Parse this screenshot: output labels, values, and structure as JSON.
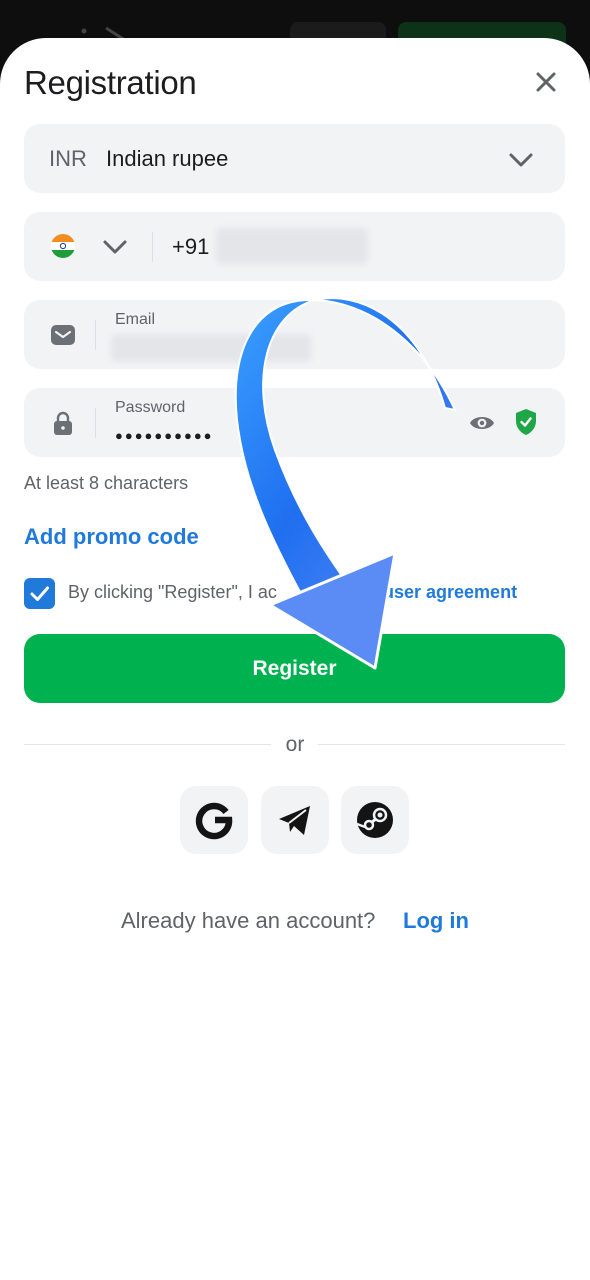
{
  "header": {
    "title": "Registration"
  },
  "currency": {
    "code": "INR",
    "name": "Indian rupee"
  },
  "phone": {
    "dial_code": "+91"
  },
  "email": {
    "label": "Email"
  },
  "password": {
    "label": "Password",
    "masked_value": "●●●●●●●●●●",
    "hint": "At least 8 characters"
  },
  "promo": {
    "label": "Add promo code"
  },
  "agreement": {
    "checked": true,
    "text": "By clicking \"Register\", I ac",
    "link_text": "user agreement"
  },
  "register": {
    "label": "Register"
  },
  "divider": {
    "label": "or"
  },
  "social": [
    {
      "name": "google-icon"
    },
    {
      "name": "telegram-icon"
    },
    {
      "name": "steam-icon"
    }
  ],
  "footer": {
    "prompt": "Already have an account?",
    "login_label": "Log in"
  },
  "colors": {
    "accent": "#1f7ad9",
    "primary_button": "#00b14f",
    "field_bg": "#f2f3f5",
    "arrow": "#2f7bf5"
  }
}
